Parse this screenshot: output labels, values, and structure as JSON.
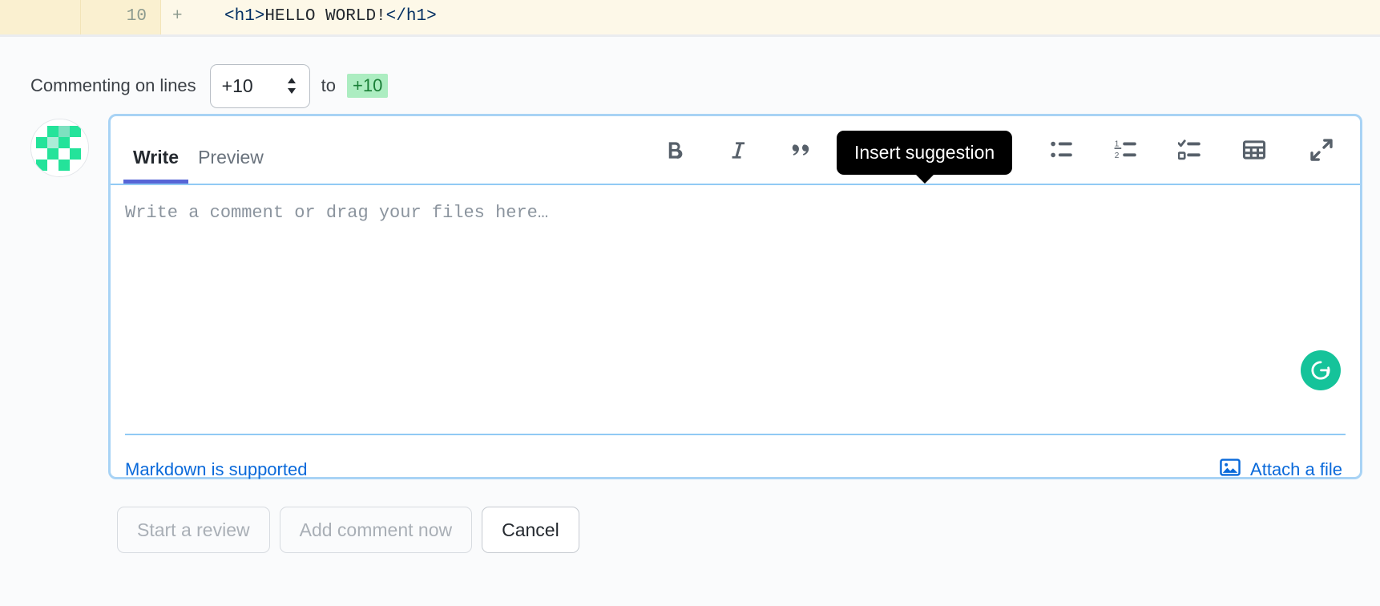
{
  "diff": {
    "line_number": "10",
    "marker": "+",
    "code_open": "<h1>",
    "code_text": "HELLO WORLD!",
    "code_close": "</h1>",
    "bg_color": "#fdf8e8",
    "gutter_color": "#faf0d0"
  },
  "commenting": {
    "label": "Commenting on lines",
    "start_line": "+10",
    "to_word": "to",
    "end_line": "+10",
    "end_line_bg": "#acedc1",
    "end_line_color": "#1a7f37"
  },
  "tooltip": {
    "text": "Insert suggestion",
    "bg_color": "#000000"
  },
  "composer": {
    "tabs": [
      {
        "label": "Write",
        "active": true
      },
      {
        "label": "Preview",
        "active": false
      }
    ],
    "toolbar": [
      {
        "name": "bold-icon",
        "title": "Bold"
      },
      {
        "name": "italic-icon",
        "title": "Italic"
      },
      {
        "name": "quote-icon",
        "title": "Quote"
      },
      {
        "name": "insert-suggestion-icon",
        "title": "Insert suggestion"
      },
      {
        "name": "code-icon",
        "title": "Code"
      },
      {
        "name": "link-icon",
        "title": "Link"
      },
      {
        "name": "unordered-list-icon",
        "title": "Unordered list"
      },
      {
        "name": "ordered-list-icon",
        "title": "Ordered list"
      },
      {
        "name": "task-list-icon",
        "title": "Task list"
      },
      {
        "name": "table-icon",
        "title": "Table"
      },
      {
        "name": "expand-icon",
        "title": "Expand"
      }
    ],
    "placeholder": "Write a comment or drag your files here…",
    "grammarly_letter": "G",
    "grammarly_color": "#15c39a",
    "markdown_link": "Markdown is supported",
    "attach_label": "Attach a file",
    "link_color": "#0969da",
    "border_color": "#a8d3f5"
  },
  "actions": [
    {
      "label": "Start a review",
      "enabled": false
    },
    {
      "label": "Add comment now",
      "enabled": false
    },
    {
      "label": "Cancel",
      "enabled": true
    }
  ]
}
